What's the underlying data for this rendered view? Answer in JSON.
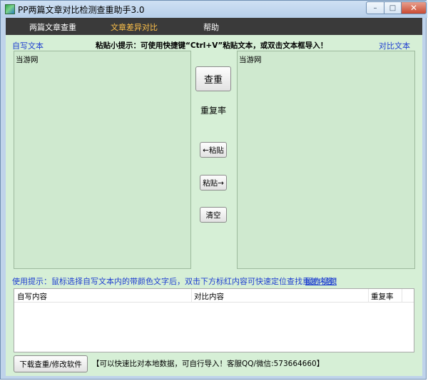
{
  "window": {
    "title": "PP两篇文章对比检测查重助手3.0"
  },
  "controls": {
    "minimize": "–",
    "maximize": "□",
    "close": "✕"
  },
  "menu": {
    "items": [
      {
        "label": "两篇文章查重",
        "active": false
      },
      {
        "label": "文章差异对比",
        "active": true
      },
      {
        "label": "帮助",
        "active": false
      }
    ]
  },
  "top_labels": {
    "left": "自写文本",
    "hint": "粘贴小提示：可使用快捷键“Ctrl+V”粘贴文本，或双击文本框导入！",
    "right": "对比文本"
  },
  "left_text": "当游网",
  "right_text": "当游网",
  "buttons": {
    "check": "查重",
    "rate_label": "重复率",
    "paste_left": "←粘贴",
    "paste_right": "粘贴→",
    "clear": "清空",
    "download": "下载查重/修改软件"
  },
  "usage": {
    "text": "使用提示：鼠标选择自写文本内的带颜色文字后，双击下方标红内容可快速定位查找重复内容！",
    "link": "操作视频"
  },
  "table": {
    "columns": [
      "自写内容",
      "对比内容",
      "重复率"
    ],
    "rows": []
  },
  "footer": "【可以快速比对本地数据，可自行导入！客服QQ/微信:573664660】",
  "colors": {
    "accent_blue": "#1f3fd0",
    "menu_active": "#ffc24a",
    "panel_green": "#d6efd6"
  }
}
